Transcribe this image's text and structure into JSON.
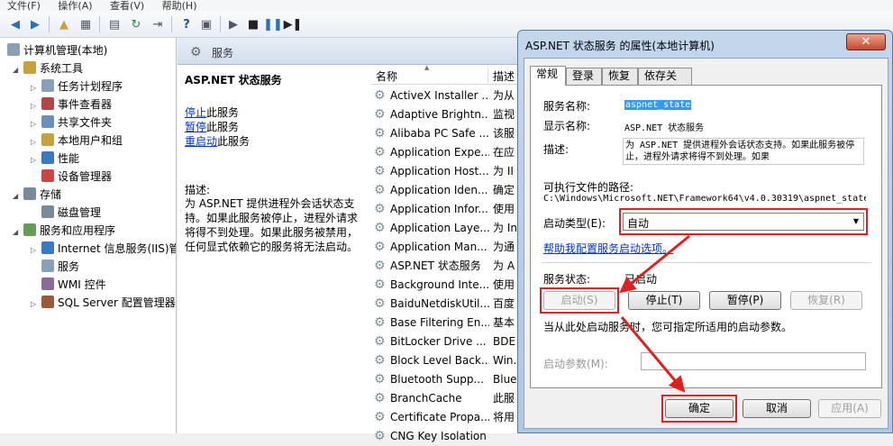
{
  "menubar": [
    "文件(F)",
    "操作(A)",
    "查看(V)",
    "帮助(H)"
  ],
  "tree": {
    "root": "计算机管理(本地)",
    "items": [
      {
        "label": "系统工具",
        "level": 1,
        "exp": "◢"
      },
      {
        "label": "任务计划程序",
        "level": 2,
        "exp": "▷"
      },
      {
        "label": "事件查看器",
        "level": 2,
        "exp": "▷"
      },
      {
        "label": "共享文件夹",
        "level": 2,
        "exp": "▷"
      },
      {
        "label": "本地用户和组",
        "level": 2,
        "exp": "▷"
      },
      {
        "label": "性能",
        "level": 2,
        "exp": "▷"
      },
      {
        "label": "设备管理器",
        "level": 2,
        "exp": ""
      },
      {
        "label": "存储",
        "level": 1,
        "exp": "◢"
      },
      {
        "label": "磁盘管理",
        "level": 2,
        "exp": ""
      },
      {
        "label": "服务和应用程序",
        "level": 1,
        "exp": "◢"
      },
      {
        "label": "Internet 信息服务(IIS)管",
        "level": 2,
        "exp": "▷"
      },
      {
        "label": "服务",
        "level": 2,
        "exp": ""
      },
      {
        "label": "WMI 控件",
        "level": 2,
        "exp": ""
      },
      {
        "label": "SQL Server 配置管理器",
        "level": 2,
        "exp": "▷"
      }
    ]
  },
  "header": {
    "title": "服务"
  },
  "description_panel": {
    "service_title": "ASP.NET 状态服务",
    "stop_link": "停止",
    "stop_suffix": "此服务",
    "pause_link": "暂停",
    "pause_suffix": "此服务",
    "restart_link": "重启动",
    "restart_suffix": "此服务",
    "desc_label": "描述:",
    "desc_text": "为 ASP.NET 提供进程外会话状态支持。如果此服务被停止，进程外请求将得不到处理。如果此服务被禁用，任何显式依赖它的服务将无法启动。"
  },
  "list": {
    "col_name": "名称",
    "col_desc": "描述",
    "rows": [
      {
        "name": "ActiveX Installer ...",
        "desc": "为从"
      },
      {
        "name": "Adaptive Brightn...",
        "desc": "监视"
      },
      {
        "name": "Alibaba PC Safe ...",
        "desc": "该服"
      },
      {
        "name": "Application Expe...",
        "desc": "在应"
      },
      {
        "name": "Application Host...",
        "desc": "为 II"
      },
      {
        "name": "Application Iden...",
        "desc": "确定"
      },
      {
        "name": "Application Infor...",
        "desc": "使用"
      },
      {
        "name": "Application Laye...",
        "desc": "为 In"
      },
      {
        "name": "Application Man...",
        "desc": "为通"
      },
      {
        "name": "ASP.NET 状态服务",
        "desc": "为 A"
      },
      {
        "name": "Background Inte...",
        "desc": "使用"
      },
      {
        "name": "BaiduNetdiskUtil...",
        "desc": "百度"
      },
      {
        "name": "Base Filtering En...",
        "desc": "基本"
      },
      {
        "name": "BitLocker Drive ...",
        "desc": "BDE"
      },
      {
        "name": "Block Level Back...",
        "desc": "Win."
      },
      {
        "name": "Bluetooth Supp...",
        "desc": "Blue"
      },
      {
        "name": "BranchCache",
        "desc": "此服"
      },
      {
        "name": "Certificate Propa...",
        "desc": "将用"
      },
      {
        "name": "CNG Key Isolation",
        "desc": ""
      }
    ]
  },
  "dialog": {
    "title": "ASP.NET 状态服务 的属性(本地计算机)",
    "close": "✕",
    "tabs": [
      "常规",
      "登录",
      "恢复",
      "依存关系"
    ],
    "service_name_label": "服务名称:",
    "service_name_value": "aspnet_state",
    "display_name_label": "显示名称:",
    "display_name_value": "ASP.NET 状态服务",
    "description_label": "描述:",
    "description_value": "为 ASP.NET 提供进程外会话状态支持。如果此服务被停止，进程外请求将得不到处理。如果",
    "exe_path_label": "可执行文件的路径:",
    "exe_path_value": "C:\\Windows\\Microsoft.NET\\Framework64\\v4.0.30319\\aspnet_state",
    "startup_type_label": "启动类型(E):",
    "startup_type_value": "自动",
    "help_link": "帮助我配置服务启动选项。",
    "status_label": "服务状态:",
    "status_value": "已启动",
    "start_btn": "启动(S)",
    "stop_btn": "停止(T)",
    "pause_btn": "暂停(P)",
    "resume_btn": "恢复(R)",
    "start_params_hint": "当从此处启动服务时，您可指定所适用的启动参数。",
    "start_params_label": "启动参数(M):",
    "ok_btn": "确定",
    "cancel_btn": "取消",
    "apply_btn": "应用(A)"
  },
  "colors": {
    "annotation": "#e02020",
    "link": "#0033cc",
    "selection": "#3399ff"
  }
}
